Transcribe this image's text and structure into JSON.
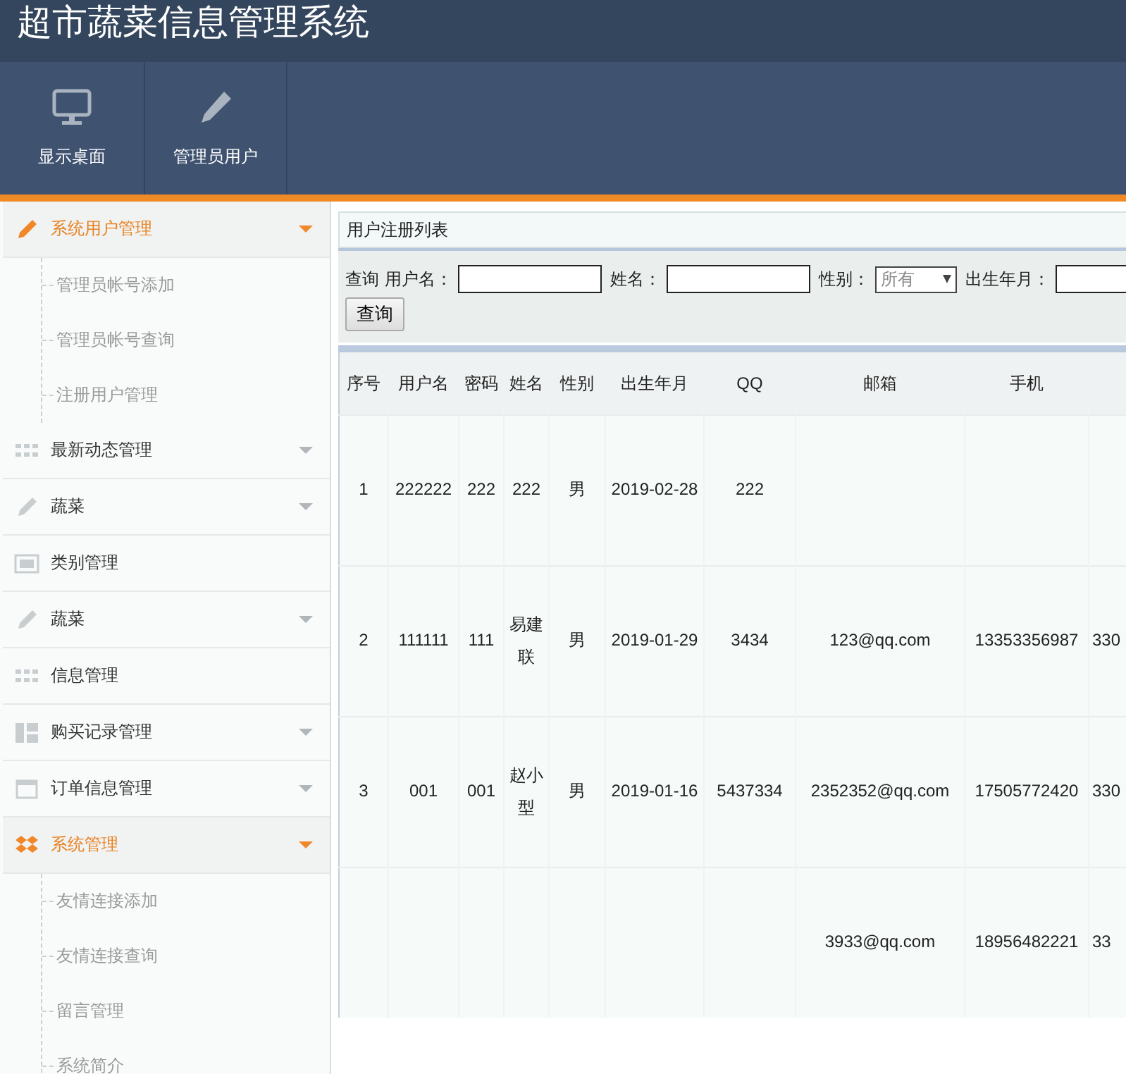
{
  "window": {
    "title": "超市蔬菜信息管理系统"
  },
  "toolbar": [
    {
      "label": "显示桌面"
    },
    {
      "label": "管理员用户"
    }
  ],
  "sidebar": {
    "items": [
      {
        "kind": "group",
        "label": "系统用户管理",
        "expanded": true,
        "children": [
          {
            "label": "管理员帐号添加"
          },
          {
            "label": "管理员帐号查询"
          },
          {
            "label": "注册用户管理"
          }
        ]
      },
      {
        "kind": "group",
        "label": "最新动态管理",
        "expanded": false
      },
      {
        "kind": "group",
        "label": "蔬菜",
        "expanded": false
      },
      {
        "kind": "item",
        "label": "类别管理"
      },
      {
        "kind": "group",
        "label": "蔬菜",
        "expanded": false
      },
      {
        "kind": "item",
        "label": "信息管理"
      },
      {
        "kind": "group",
        "label": "购买记录管理",
        "expanded": false
      },
      {
        "kind": "group",
        "label": "订单信息管理",
        "expanded": false
      },
      {
        "kind": "group",
        "label": "系统管理",
        "expanded": true,
        "children": [
          {
            "label": "友情连接添加"
          },
          {
            "label": "友情连接查询"
          },
          {
            "label": "留言管理"
          },
          {
            "label": "系统简介"
          }
        ]
      }
    ]
  },
  "panel": {
    "title": "用户注册列表",
    "search": {
      "label": "查询",
      "fields": [
        {
          "kind": "text",
          "label": "用户名："
        },
        {
          "kind": "text",
          "label": "姓名："
        },
        {
          "kind": "select",
          "label": "性别：",
          "value": "所有"
        },
        {
          "kind": "text",
          "label": "出生年月："
        }
      ],
      "button": "查询"
    },
    "table": {
      "columns": [
        "序号",
        "用户名",
        "密码",
        "姓名",
        "性别",
        "出生年月",
        "QQ",
        "邮箱",
        "手机"
      ],
      "rows": [
        {
          "no": "1",
          "username": "222222",
          "password": "222",
          "name": "222",
          "gender": "男",
          "birth": "2019-02-28",
          "qq": "222"
        },
        {
          "no": "2",
          "username": "111111",
          "password": "111",
          "name": "易建联",
          "gender": "男",
          "birth": "2019-01-29",
          "qq": "3434",
          "email": "123@qq.com",
          "phone": "13353356987",
          "column_10": "330"
        },
        {
          "no": "3",
          "username": "001",
          "password": "001",
          "name": "赵小型",
          "gender": "男",
          "birth": "2019-01-16",
          "qq": "5437334",
          "email": "2352352@qq.com",
          "phone": "17505772420",
          "column_10": "330"
        },
        {
          "email": "3933@qq.com",
          "phone": "18956482221",
          "column_10": "33"
        }
      ]
    }
  }
}
